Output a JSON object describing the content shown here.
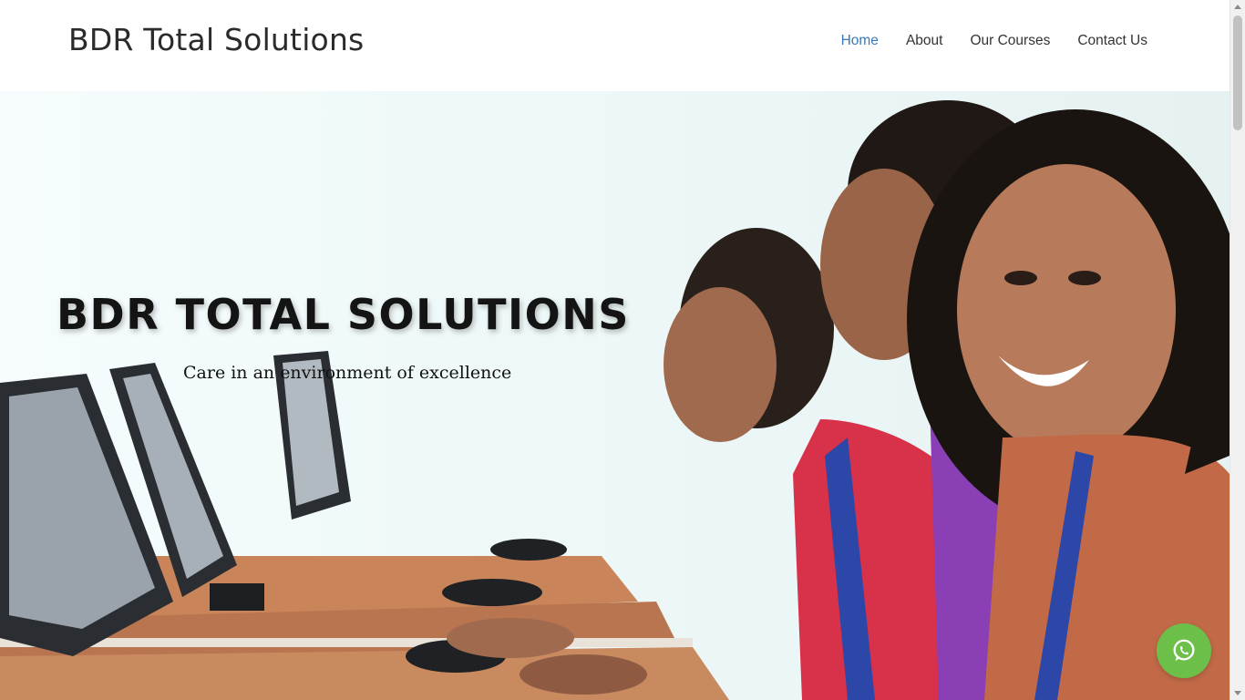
{
  "header": {
    "logo_text": "BDR Total Solutions",
    "nav": [
      {
        "label": "Home",
        "active": true
      },
      {
        "label": "About",
        "active": false
      },
      {
        "label": "Our Courses",
        "active": false
      },
      {
        "label": "Contact Us",
        "active": false
      }
    ]
  },
  "hero": {
    "title": "BDR TOTAL SOLUTIONS",
    "subtitle": "Care in an environment of excellence",
    "image_description_icon": "students-at-computers-photo"
  },
  "floating": {
    "whatsapp_icon": "whatsapp-icon"
  },
  "colors": {
    "nav_active": "#3b78b8",
    "whatsapp_green": "#6cc04a",
    "text_dark": "#2b2b2b"
  }
}
